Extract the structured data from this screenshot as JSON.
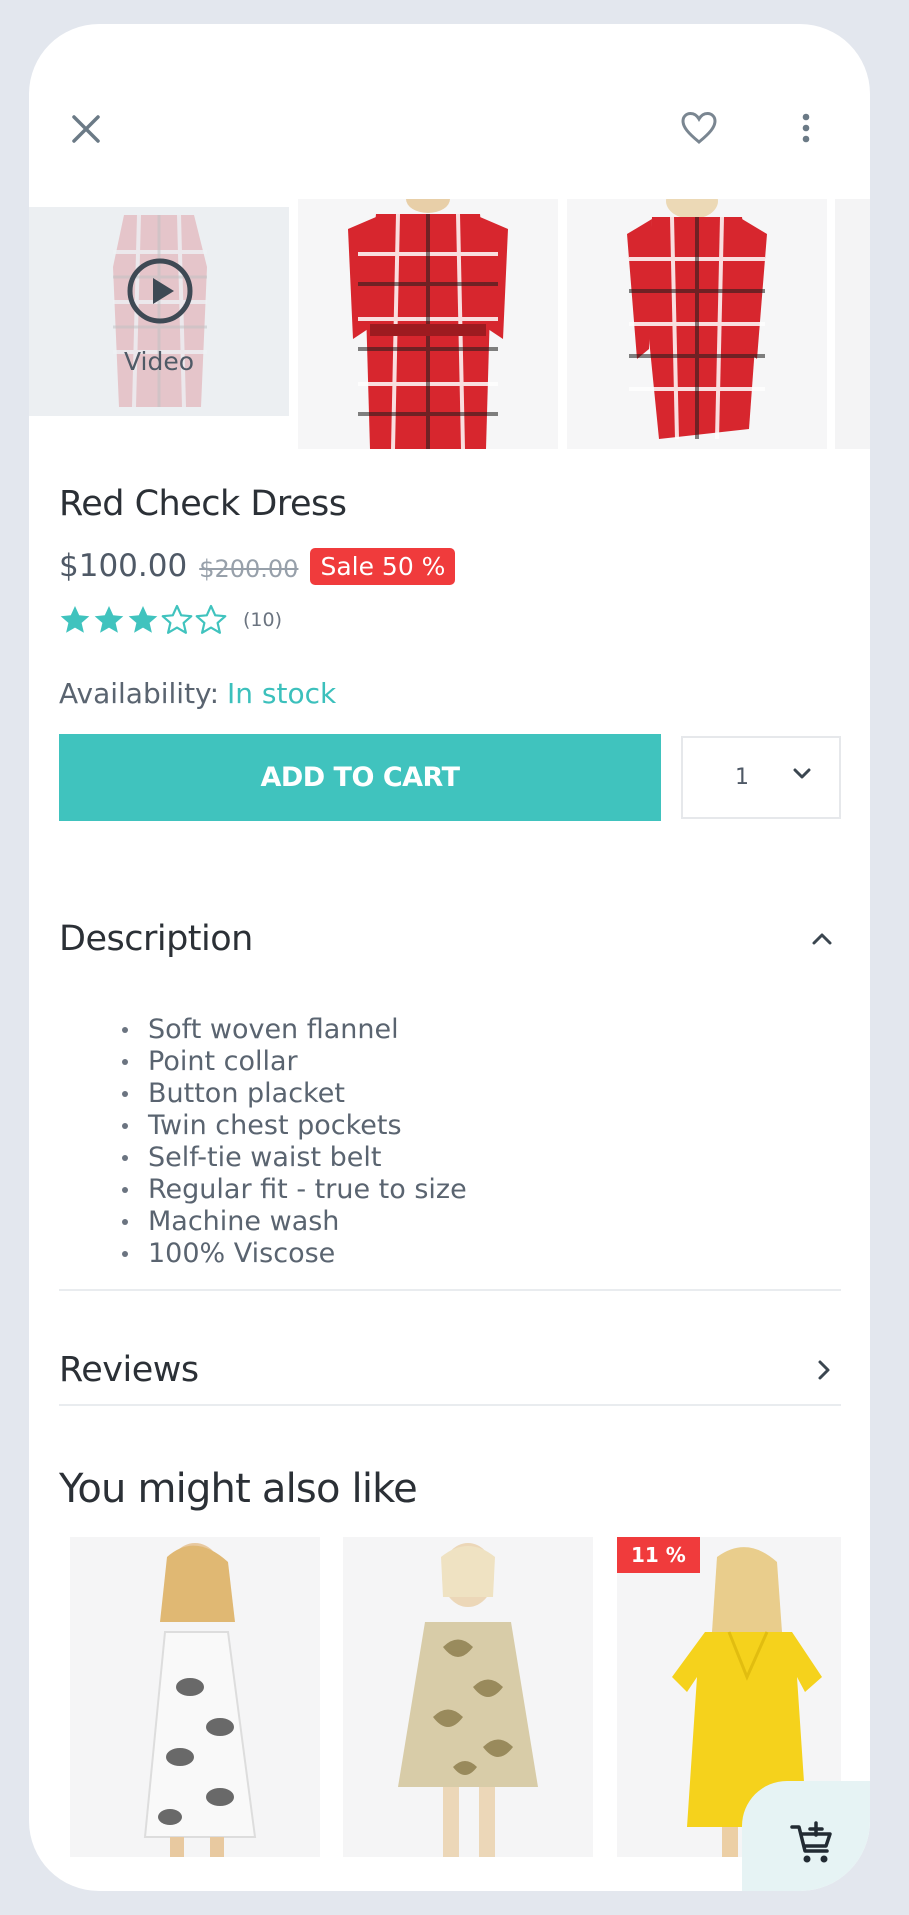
{
  "product": {
    "title": "Red Check Dress",
    "price": "$100.00",
    "old_price": "$200.00",
    "sale_label": "Sale 50 %",
    "rating": 3,
    "rating_max": 5,
    "rating_count": "(10)",
    "availability_label": "Availability:",
    "availability_value": "In stock"
  },
  "gallery": {
    "video_label": "Video"
  },
  "cart": {
    "button_label": "ADD TO CART",
    "quantity": "1"
  },
  "description": {
    "title": "Description",
    "items": [
      "Soft woven flannel",
      "Point collar",
      "Button placket",
      "Twin chest pockets",
      "Self-tie waist belt",
      "Regular fit - true to size",
      "Machine wash",
      "100% Viscose"
    ]
  },
  "reviews": {
    "title": "Reviews"
  },
  "recommendations": {
    "title": "You might also like",
    "products": [
      {
        "discount": ""
      },
      {
        "discount": ""
      },
      {
        "discount": "11 %"
      }
    ]
  },
  "colors": {
    "accent": "#40c3be",
    "sale": "#f03b3c",
    "text_dark": "#2b3036",
    "text_muted": "#5a6470"
  },
  "icons": [
    "close-icon",
    "heart-icon",
    "more-vertical-icon",
    "play-icon",
    "star-icon",
    "chevron-down-icon",
    "chevron-up-icon",
    "chevron-right-icon",
    "add-to-cart-icon"
  ]
}
